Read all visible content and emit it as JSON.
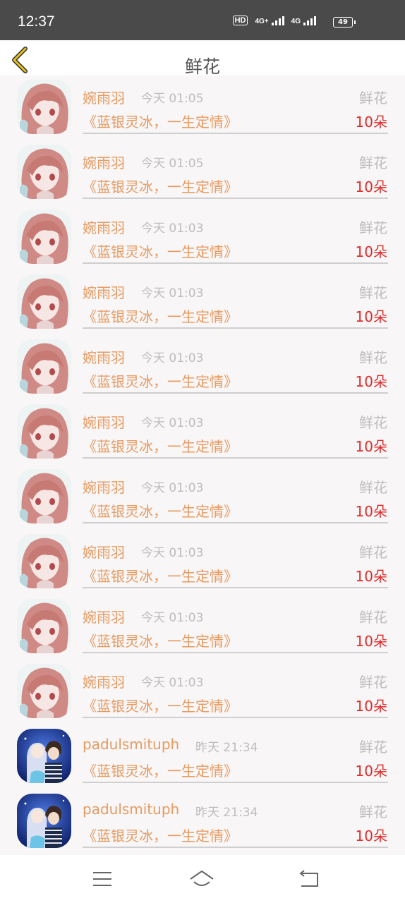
{
  "status": {
    "time": "12:37",
    "hd": "HD",
    "net1": "4G+",
    "net2": "4G",
    "battery": "49"
  },
  "header": {
    "title": "鲜花"
  },
  "rows": [
    {
      "user": "婉雨羽",
      "time": "今天 01:05",
      "kind": "鲜花",
      "book": "《蓝银灵冰，一生定情》",
      "count": "10朵",
      "avatar": "anime-girl"
    },
    {
      "user": "婉雨羽",
      "time": "今天 01:05",
      "kind": "鲜花",
      "book": "《蓝银灵冰，一生定情》",
      "count": "10朵",
      "avatar": "anime-girl"
    },
    {
      "user": "婉雨羽",
      "time": "今天 01:03",
      "kind": "鲜花",
      "book": "《蓝银灵冰，一生定情》",
      "count": "10朵",
      "avatar": "anime-girl"
    },
    {
      "user": "婉雨羽",
      "time": "今天 01:03",
      "kind": "鲜花",
      "book": "《蓝银灵冰，一生定情》",
      "count": "10朵",
      "avatar": "anime-girl"
    },
    {
      "user": "婉雨羽",
      "time": "今天 01:03",
      "kind": "鲜花",
      "book": "《蓝银灵冰，一生定情》",
      "count": "10朵",
      "avatar": "anime-girl"
    },
    {
      "user": "婉雨羽",
      "time": "今天 01:03",
      "kind": "鲜花",
      "book": "《蓝银灵冰，一生定情》",
      "count": "10朵",
      "avatar": "anime-girl"
    },
    {
      "user": "婉雨羽",
      "time": "今天 01:03",
      "kind": "鲜花",
      "book": "《蓝银灵冰，一生定情》",
      "count": "10朵",
      "avatar": "anime-girl"
    },
    {
      "user": "婉雨羽",
      "time": "今天 01:03",
      "kind": "鲜花",
      "book": "《蓝银灵冰，一生定情》",
      "count": "10朵",
      "avatar": "anime-girl"
    },
    {
      "user": "婉雨羽",
      "time": "今天 01:03",
      "kind": "鲜花",
      "book": "《蓝银灵冰，一生定情》",
      "count": "10朵",
      "avatar": "anime-girl"
    },
    {
      "user": "婉雨羽",
      "time": "今天 01:03",
      "kind": "鲜花",
      "book": "《蓝银灵冰，一生定情》",
      "count": "10朵",
      "avatar": "anime-girl"
    },
    {
      "user": "padulsmituph",
      "time": "昨天 21:34",
      "kind": "鲜花",
      "book": "《蓝银灵冰，一生定情》",
      "count": "10朵",
      "avatar": "anime-couple"
    },
    {
      "user": "padulsmituph",
      "time": "昨天 21:34",
      "kind": "鲜花",
      "book": "《蓝银灵冰，一生定情》",
      "count": "10朵",
      "avatar": "anime-couple"
    }
  ],
  "navbar": {
    "icons": [
      "menu-icon",
      "home-icon",
      "back-icon"
    ]
  },
  "colors": {
    "username": "#e79a61",
    "count": "#e02b2b",
    "muted": "#bdbdbd",
    "accent": "#e7c21a"
  }
}
